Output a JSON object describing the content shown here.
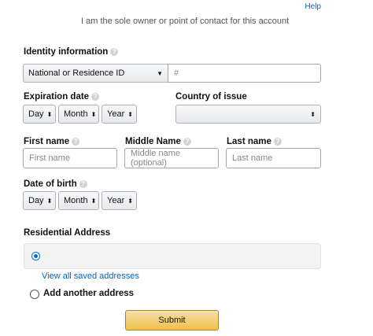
{
  "header": {
    "help_link": "Help",
    "owner_note": "I am the sole owner or point of contact for this account"
  },
  "identity": {
    "label": "Identity information",
    "id_type_selected": "National or Residence ID",
    "id_number_placeholder": "#"
  },
  "expiration": {
    "label": "Expiration date",
    "day": "Day",
    "month": "Month",
    "year": "Year"
  },
  "country": {
    "label": "Country of issue",
    "selected": ""
  },
  "name": {
    "first_label": "First name",
    "first_placeholder": "First name",
    "middle_label": "Middle Name",
    "middle_placeholder": "Middle name (optional)",
    "last_label": "Last name",
    "last_placeholder": "Last name"
  },
  "dob": {
    "label": "Date of birth",
    "day": "Day",
    "month": "Month",
    "year": "Year"
  },
  "address": {
    "label": "Residential Address",
    "view_all_link": "View all saved addresses",
    "add_another_label": "Add another address"
  },
  "actions": {
    "submit_label": "Submit"
  },
  "icons": {
    "info": "info-icon",
    "select_arrows": "updown-arrows-icon",
    "dropdown_caret": "caret-down-icon"
  },
  "colors": {
    "link": "#0066c0",
    "submit_bg": "#f0c14b",
    "radio_selected": "#0a6ed1"
  }
}
